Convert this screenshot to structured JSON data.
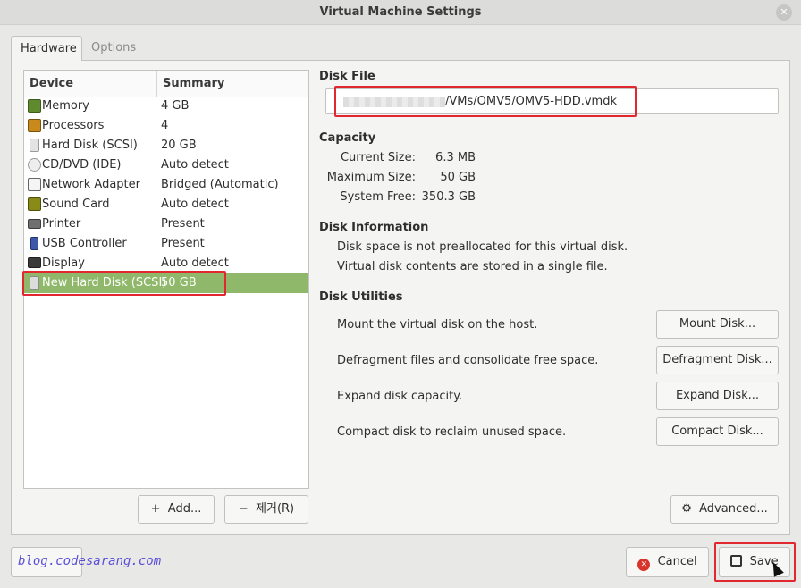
{
  "window": {
    "title": "Virtual Machine Settings"
  },
  "tabs": [
    {
      "label": "Hardware"
    },
    {
      "label": "Options"
    }
  ],
  "device_list": {
    "headers": {
      "device": "Device",
      "summary": "Summary"
    },
    "rows": [
      {
        "icon": "memory-icon",
        "name": "Memory",
        "summary": "4 GB"
      },
      {
        "icon": "processor-icon",
        "name": "Processors",
        "summary": "4"
      },
      {
        "icon": "hard-disk-icon",
        "name": "Hard Disk (SCSI)",
        "summary": "20 GB"
      },
      {
        "icon": "cd-dvd-icon",
        "name": "CD/DVD (IDE)",
        "summary": "Auto detect"
      },
      {
        "icon": "network-adapter-icon",
        "name": "Network Adapter",
        "summary": "Bridged (Automatic)"
      },
      {
        "icon": "sound-card-icon",
        "name": "Sound Card",
        "summary": "Auto detect"
      },
      {
        "icon": "printer-icon",
        "name": "Printer",
        "summary": "Present"
      },
      {
        "icon": "usb-controller-icon",
        "name": "USB Controller",
        "summary": "Present"
      },
      {
        "icon": "display-icon",
        "name": "Display",
        "summary": "Auto detect"
      },
      {
        "icon": "hard-disk-icon",
        "name": "New Hard Disk (SCSI)",
        "summary": "50 GB",
        "selected": true
      }
    ],
    "add_button": "Add...",
    "remove_button": "제거(R)"
  },
  "disk_file": {
    "title": "Disk File",
    "path_visible": "/VMs/OMV5/OMV5-HDD.vmdk"
  },
  "capacity": {
    "title": "Capacity",
    "current_size_label": "Current Size:",
    "current_size_value": "6.3 MB",
    "maximum_size_label": "Maximum Size:",
    "maximum_size_value": "50 GB",
    "system_free_label": "System Free:",
    "system_free_value": "350.3 GB"
  },
  "disk_information": {
    "title": "Disk Information",
    "line1": "Disk space is not preallocated for this virtual disk.",
    "line2": "Virtual disk contents are stored in a single file."
  },
  "disk_utilities": {
    "title": "Disk Utilities",
    "mount_text": "Mount the virtual disk on the host.",
    "mount_button": "Mount Disk...",
    "defrag_text": "Defragment files and consolidate free space.",
    "defrag_button": "Defragment Disk...",
    "expand_text": "Expand disk capacity.",
    "expand_button": "Expand Disk...",
    "compact_text": "Compact disk to reclaim unused space.",
    "compact_button": "Compact Disk..."
  },
  "advanced_button": "Advanced...",
  "footer": {
    "cancel_button": "Cancel",
    "save_button": "Save",
    "watermark": "blog.codesarang.com"
  },
  "colors": {
    "selection": "#8fb86a",
    "highlight": "#e0282e",
    "cancel_icon": "#d9342b"
  }
}
